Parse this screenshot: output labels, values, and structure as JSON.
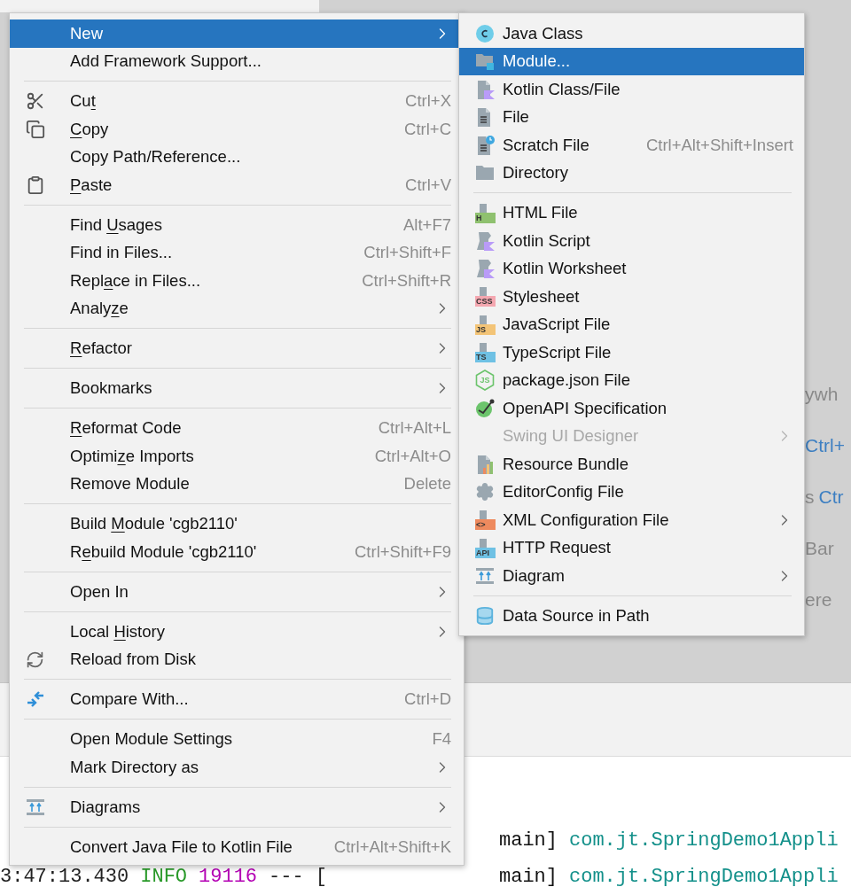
{
  "context_menu": {
    "items": [
      {
        "kind": "plain",
        "label": "New",
        "selected": true,
        "has_submenu": true
      },
      {
        "kind": "plain",
        "label": "Add Framework Support...",
        "selected": false
      },
      {
        "kind": "separator"
      },
      {
        "kind": "scissors",
        "text_before": "Cu",
        "mnemonic": "t",
        "shortcut": "Ctrl+X",
        "selected": false
      },
      {
        "kind": "copy",
        "mnemonic": "C",
        "text_after": "opy",
        "shortcut": "Ctrl+C",
        "selected": false
      },
      {
        "kind": "plain",
        "label": "Copy Path/Reference...",
        "selected": false
      },
      {
        "kind": "clipboard",
        "mnemonic": "P",
        "text_after": "aste",
        "shortcut": "Ctrl+V",
        "selected": false
      },
      {
        "kind": "separator"
      },
      {
        "kind": "plain",
        "text_before": "Find ",
        "mnemonic": "U",
        "text_after": "sages",
        "shortcut": "Alt+F7",
        "selected": false
      },
      {
        "kind": "plain",
        "label": "Find in Files...",
        "shortcut": "Ctrl+Shift+F",
        "selected": false
      },
      {
        "kind": "plain",
        "text_before": "Repl",
        "mnemonic": "a",
        "text_after": "ce in Files...",
        "shortcut": "Ctrl+Shift+R",
        "selected": false
      },
      {
        "kind": "plain",
        "text_before": "Analy",
        "mnemonic": "z",
        "text_after": "e",
        "has_submenu": true,
        "selected": false
      },
      {
        "kind": "separator"
      },
      {
        "kind": "plain",
        "mnemonic": "R",
        "text_after": "efactor",
        "has_submenu": true,
        "selected": false
      },
      {
        "kind": "separator"
      },
      {
        "kind": "plain",
        "label": "Bookmarks",
        "has_submenu": true,
        "selected": false
      },
      {
        "kind": "separator"
      },
      {
        "kind": "plain",
        "mnemonic": "R",
        "text_after": "eformat Code",
        "shortcut": "Ctrl+Alt+L",
        "selected": false
      },
      {
        "kind": "plain",
        "text_before": "Optimi",
        "mnemonic": "z",
        "text_after": "e Imports",
        "shortcut": "Ctrl+Alt+O",
        "selected": false
      },
      {
        "kind": "plain",
        "label": "Remove Module",
        "shortcut": "Delete",
        "selected": false
      },
      {
        "kind": "separator"
      },
      {
        "kind": "plain",
        "text_before": "Build ",
        "mnemonic": "M",
        "text_after": "odule 'cgb2110'",
        "selected": false
      },
      {
        "kind": "plain",
        "text_before": "R",
        "mnemonic": "e",
        "text_after": "build Module 'cgb2110'",
        "shortcut": "Ctrl+Shift+F9",
        "selected": false
      },
      {
        "kind": "separator"
      },
      {
        "kind": "plain",
        "label": "Open In",
        "has_submenu": true,
        "selected": false
      },
      {
        "kind": "separator"
      },
      {
        "kind": "plain",
        "text_before": "Local ",
        "mnemonic": "H",
        "text_after": "istory",
        "has_submenu": true,
        "selected": false
      },
      {
        "kind": "reload",
        "label": "Reload from Disk",
        "selected": false
      },
      {
        "kind": "separator"
      },
      {
        "kind": "compare",
        "label": "Compare With...",
        "shortcut": "Ctrl+D",
        "selected": false
      },
      {
        "kind": "separator"
      },
      {
        "kind": "plain",
        "label": "Open Module Settings",
        "shortcut": "F4",
        "selected": false
      },
      {
        "kind": "plain",
        "label": "Mark Directory as",
        "has_submenu": true,
        "selected": false
      },
      {
        "kind": "separator"
      },
      {
        "kind": "diagram",
        "label": "Diagrams",
        "has_submenu": true,
        "selected": false
      },
      {
        "kind": "separator"
      },
      {
        "kind": "plain",
        "label": "Convert Java File to Kotlin File",
        "shortcut": "Ctrl+Alt+Shift+K",
        "selected": false
      }
    ]
  },
  "new_submenu": {
    "items": [
      {
        "kind": "java",
        "label": "Java Class",
        "selected": false,
        "disabled": false
      },
      {
        "kind": "module",
        "label": "Module...",
        "selected": true,
        "disabled": false
      },
      {
        "kind": "kotlinfile",
        "label": "Kotlin Class/File",
        "selected": false,
        "disabled": false
      },
      {
        "kind": "file",
        "label": "File",
        "selected": false,
        "disabled": false
      },
      {
        "kind": "scratch",
        "label": "Scratch File",
        "shortcut": "Ctrl+Alt+Shift+Insert",
        "selected": false,
        "disabled": false
      },
      {
        "kind": "folder",
        "label": "Directory",
        "selected": false,
        "disabled": false
      },
      {
        "kind": "separator"
      },
      {
        "kind": "badged",
        "badge": "H",
        "color": "#8fc16f",
        "label": "HTML File",
        "selected": false,
        "disabled": false
      },
      {
        "kind": "kotlinscript",
        "label": "Kotlin Script",
        "selected": false,
        "disabled": false
      },
      {
        "kind": "kotlinscript",
        "label": "Kotlin Worksheet",
        "selected": false,
        "disabled": false
      },
      {
        "kind": "badged",
        "badge": "CSS",
        "color": "#f4a7b0",
        "label": "Stylesheet",
        "selected": false,
        "disabled": false
      },
      {
        "kind": "badged",
        "badge": "JS",
        "color": "#f3c477",
        "label": "JavaScript File",
        "selected": false,
        "disabled": false
      },
      {
        "kind": "badged",
        "badge": "TS",
        "color": "#6fc1e4",
        "label": "TypeScript File",
        "selected": false,
        "disabled": false
      },
      {
        "kind": "node",
        "badge": "JS",
        "label": "package.json File",
        "selected": false,
        "disabled": false
      },
      {
        "kind": "openapi",
        "label": "OpenAPI Specification",
        "selected": false,
        "disabled": false
      },
      {
        "kind": "plain",
        "label": "Swing UI Designer",
        "has_submenu": true,
        "selected": false,
        "disabled": true
      },
      {
        "kind": "bundle",
        "label": "Resource Bundle",
        "selected": false,
        "disabled": false
      },
      {
        "kind": "gear",
        "label": "EditorConfig File",
        "selected": false,
        "disabled": false
      },
      {
        "kind": "badged",
        "badge": "<>",
        "color": "#ee8a5e",
        "label": "XML Configuration File",
        "has_submenu": true,
        "selected": false,
        "disabled": false
      },
      {
        "kind": "badged",
        "badge": "API",
        "color": "#6fc1e4",
        "label": "HTTP Request",
        "selected": false,
        "disabled": false
      },
      {
        "kind": "diagram",
        "label": "Diagram",
        "has_submenu": true,
        "selected": false,
        "disabled": false
      },
      {
        "kind": "separator"
      },
      {
        "kind": "database",
        "label": "Data Source in Path",
        "selected": false,
        "disabled": false
      }
    ]
  },
  "editor_hints": [
    [
      {
        "kind": "plain",
        "text": "ywh"
      }
    ],
    [
      {
        "kind": "key",
        "text": "Ctrl+"
      }
    ],
    [
      {
        "kind": "plain",
        "text": "s"
      },
      {
        "kind": "key",
        "text": "Ctr"
      }
    ],
    [
      {
        "kind": "plain",
        "text": "Bar"
      }
    ],
    [
      {
        "kind": "plain",
        "text": "ere"
      }
    ]
  ],
  "console": {
    "lines": [
      {
        "thread": "main]",
        "logger": "com.jt.SpringDemo1Appli"
      },
      {
        "time": "3:47:13.430",
        "level": "INFO",
        "pid": "19116",
        "separator": "--- [",
        "thread": "main]",
        "logger": "com.jt.SpringDemo1Appli"
      }
    ]
  }
}
